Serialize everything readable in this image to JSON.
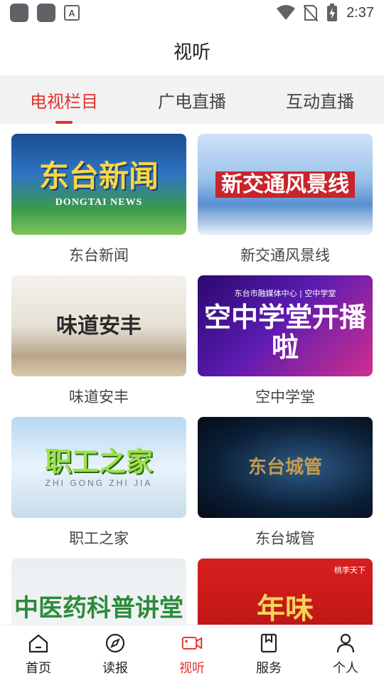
{
  "status_bar": {
    "time": "2:37",
    "a_icon_letter": "A"
  },
  "header": {
    "title": "视听"
  },
  "tabs": [
    {
      "label": "电视栏目",
      "active": true
    },
    {
      "label": "广电直播",
      "active": false
    },
    {
      "label": "互动直播",
      "active": false
    }
  ],
  "programs": [
    {
      "name": "东台新闻",
      "thumb_title": "东台新闻",
      "thumb_subtitle": "DONGTAI NEWS"
    },
    {
      "name": "新交通风景线",
      "thumb_title": "新交通风景线"
    },
    {
      "name": "味道安丰",
      "thumb_title": "味道安丰"
    },
    {
      "name": "空中学堂",
      "thumb_title": "空中学堂开播啦",
      "thumb_top": "东台市融媒体中心 | 空中学堂"
    },
    {
      "name": "职工之家",
      "thumb_title": "职工之家",
      "thumb_subtitle": "ZHI GONG ZHI JIA"
    },
    {
      "name": "东台城管",
      "thumb_title": "东台城管"
    },
    {
      "name": "",
      "thumb_title": "中医药科普讲堂"
    },
    {
      "name": "",
      "thumb_title": "年味",
      "thumb_corner": "桃李天下"
    }
  ],
  "bottom_nav": [
    {
      "label": "首页",
      "icon": "home-icon",
      "active": false
    },
    {
      "label": "读报",
      "icon": "compass-icon",
      "active": false
    },
    {
      "label": "视听",
      "icon": "video-camera-icon",
      "active": true
    },
    {
      "label": "服务",
      "icon": "bookmark-icon",
      "active": false
    },
    {
      "label": "个人",
      "icon": "person-icon",
      "active": false
    }
  ],
  "colors": {
    "accent": "#e3312d",
    "tab_bar_bg": "#f2f2f2"
  }
}
